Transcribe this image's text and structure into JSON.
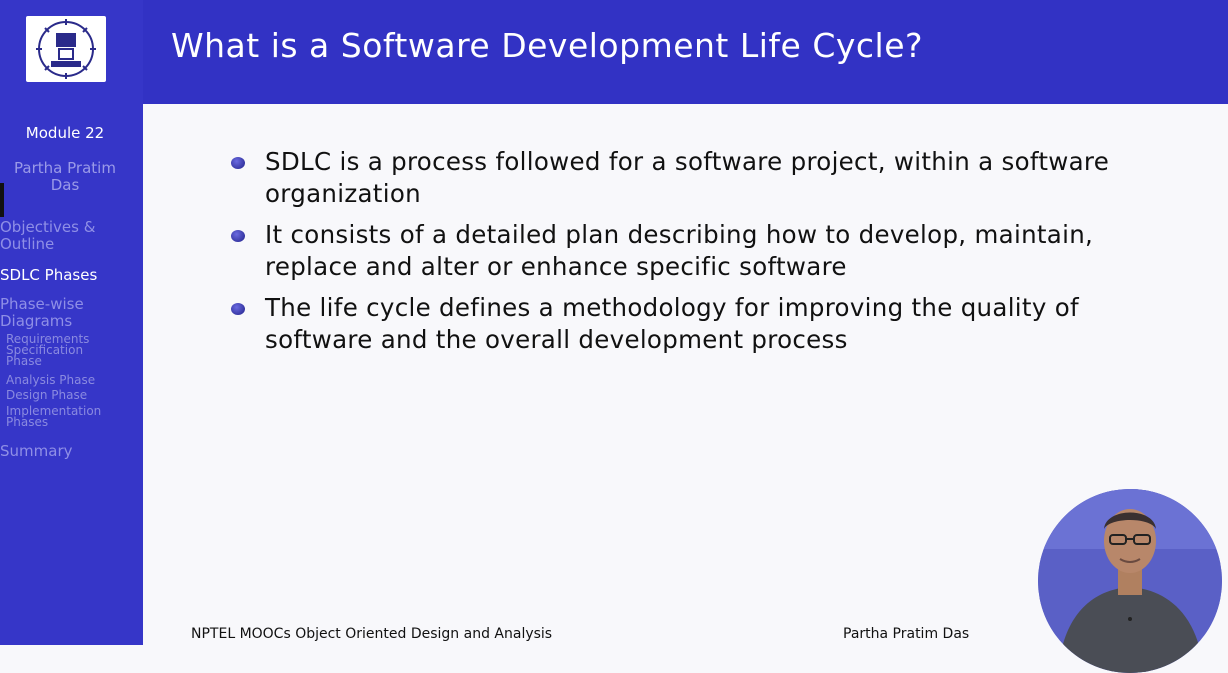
{
  "slide": {
    "title": "What is a Software Development Life Cycle?",
    "bullets": [
      "SDLC is a process followed for a software project, within a software organization",
      "It consists of a detailed plan describing how to develop, maintain, replace and alter or enhance specific software",
      "The life cycle defines a methodology for improving the quality of software and the overall development process"
    ]
  },
  "sidebar": {
    "module": "Module 22",
    "author": "Partha Pratim Das",
    "items": {
      "objectives": "Objectives & Outline",
      "sdlc_phases": "SDLC Phases",
      "phase_wise": "Phase-wise Diagrams",
      "requirements": "Requirements Specification Phase",
      "analysis": "Analysis Phase",
      "design": "Design Phase",
      "implementation": "Implementation Phases",
      "summary": "Summary"
    },
    "active": "SDLC Phases"
  },
  "footer": {
    "course": "NPTEL MOOCs Object Oriented Design and Analysis",
    "author": "Partha Pratim Das"
  },
  "colors": {
    "header": "#3232c4",
    "sidebar": "#3636c8",
    "active_nav": "#ffffff",
    "inactive_nav": "#8f8fe6",
    "bullet": "#2a2a9a"
  },
  "icons": [
    "institute-logo-icon",
    "bullet-icon",
    "presenter-webcam",
    "screen-toolbar",
    "mouse-cursor-icon"
  ]
}
